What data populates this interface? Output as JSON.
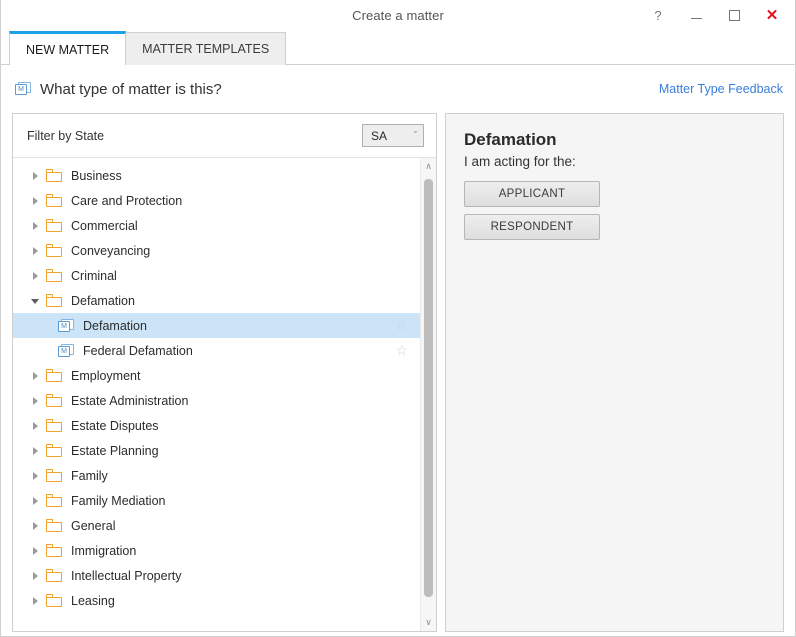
{
  "window": {
    "title": "Create a matter",
    "controls": {
      "help": "?",
      "minimize": "",
      "maximize": "",
      "close": "✕"
    }
  },
  "tabs": [
    {
      "label": "NEW MATTER",
      "active": true
    },
    {
      "label": "MATTER TEMPLATES",
      "active": false
    }
  ],
  "question": {
    "icon": "matter-type-icon",
    "icon_letter": "M",
    "text": "What type of matter is this?",
    "feedback_link": "Matter Type Feedback"
  },
  "filter": {
    "label": "Filter by State",
    "selected_state": "SA",
    "chevron": "ˇ"
  },
  "tree": {
    "nodes": [
      {
        "label": "Business",
        "type": "folder",
        "expanded": false,
        "selected": false
      },
      {
        "label": "Care and Protection",
        "type": "folder",
        "expanded": false,
        "selected": false
      },
      {
        "label": "Commercial",
        "type": "folder",
        "expanded": false,
        "selected": false
      },
      {
        "label": "Conveyancing",
        "type": "folder",
        "expanded": false,
        "selected": false
      },
      {
        "label": "Criminal",
        "type": "folder",
        "expanded": false,
        "selected": false
      },
      {
        "label": "Defamation",
        "type": "folder",
        "expanded": true,
        "selected": false
      },
      {
        "label": "Defamation",
        "type": "matter",
        "expanded": false,
        "selected": true,
        "star": "☆"
      },
      {
        "label": "Federal Defamation",
        "type": "matter",
        "expanded": false,
        "selected": false,
        "star": "☆"
      },
      {
        "label": "Employment",
        "type": "folder",
        "expanded": false,
        "selected": false
      },
      {
        "label": "Estate Administration",
        "type": "folder",
        "expanded": false,
        "selected": false
      },
      {
        "label": "Estate Disputes",
        "type": "folder",
        "expanded": false,
        "selected": false
      },
      {
        "label": "Estate Planning",
        "type": "folder",
        "expanded": false,
        "selected": false
      },
      {
        "label": "Family",
        "type": "folder",
        "expanded": false,
        "selected": false
      },
      {
        "label": "Family Mediation",
        "type": "folder",
        "expanded": false,
        "selected": false
      },
      {
        "label": "General",
        "type": "folder",
        "expanded": false,
        "selected": false
      },
      {
        "label": "Immigration",
        "type": "folder",
        "expanded": false,
        "selected": false
      },
      {
        "label": "Intellectual Property",
        "type": "folder",
        "expanded": false,
        "selected": false
      },
      {
        "label": "Leasing",
        "type": "folder",
        "expanded": false,
        "selected": false
      }
    ],
    "scrollbar": {
      "up": "∧",
      "down": "∨"
    }
  },
  "detail": {
    "title": "Defamation",
    "subtitle": "I am acting for the:",
    "buttons": [
      {
        "label": "APPLICANT"
      },
      {
        "label": "RESPONDENT"
      }
    ]
  },
  "colors": {
    "accent": "#1e9fe8",
    "link": "#3b7dd8",
    "selection": "#cce4f7",
    "folder": "#f0a32a",
    "matter_icon": "#5b9bd5",
    "close": "#e81123"
  }
}
